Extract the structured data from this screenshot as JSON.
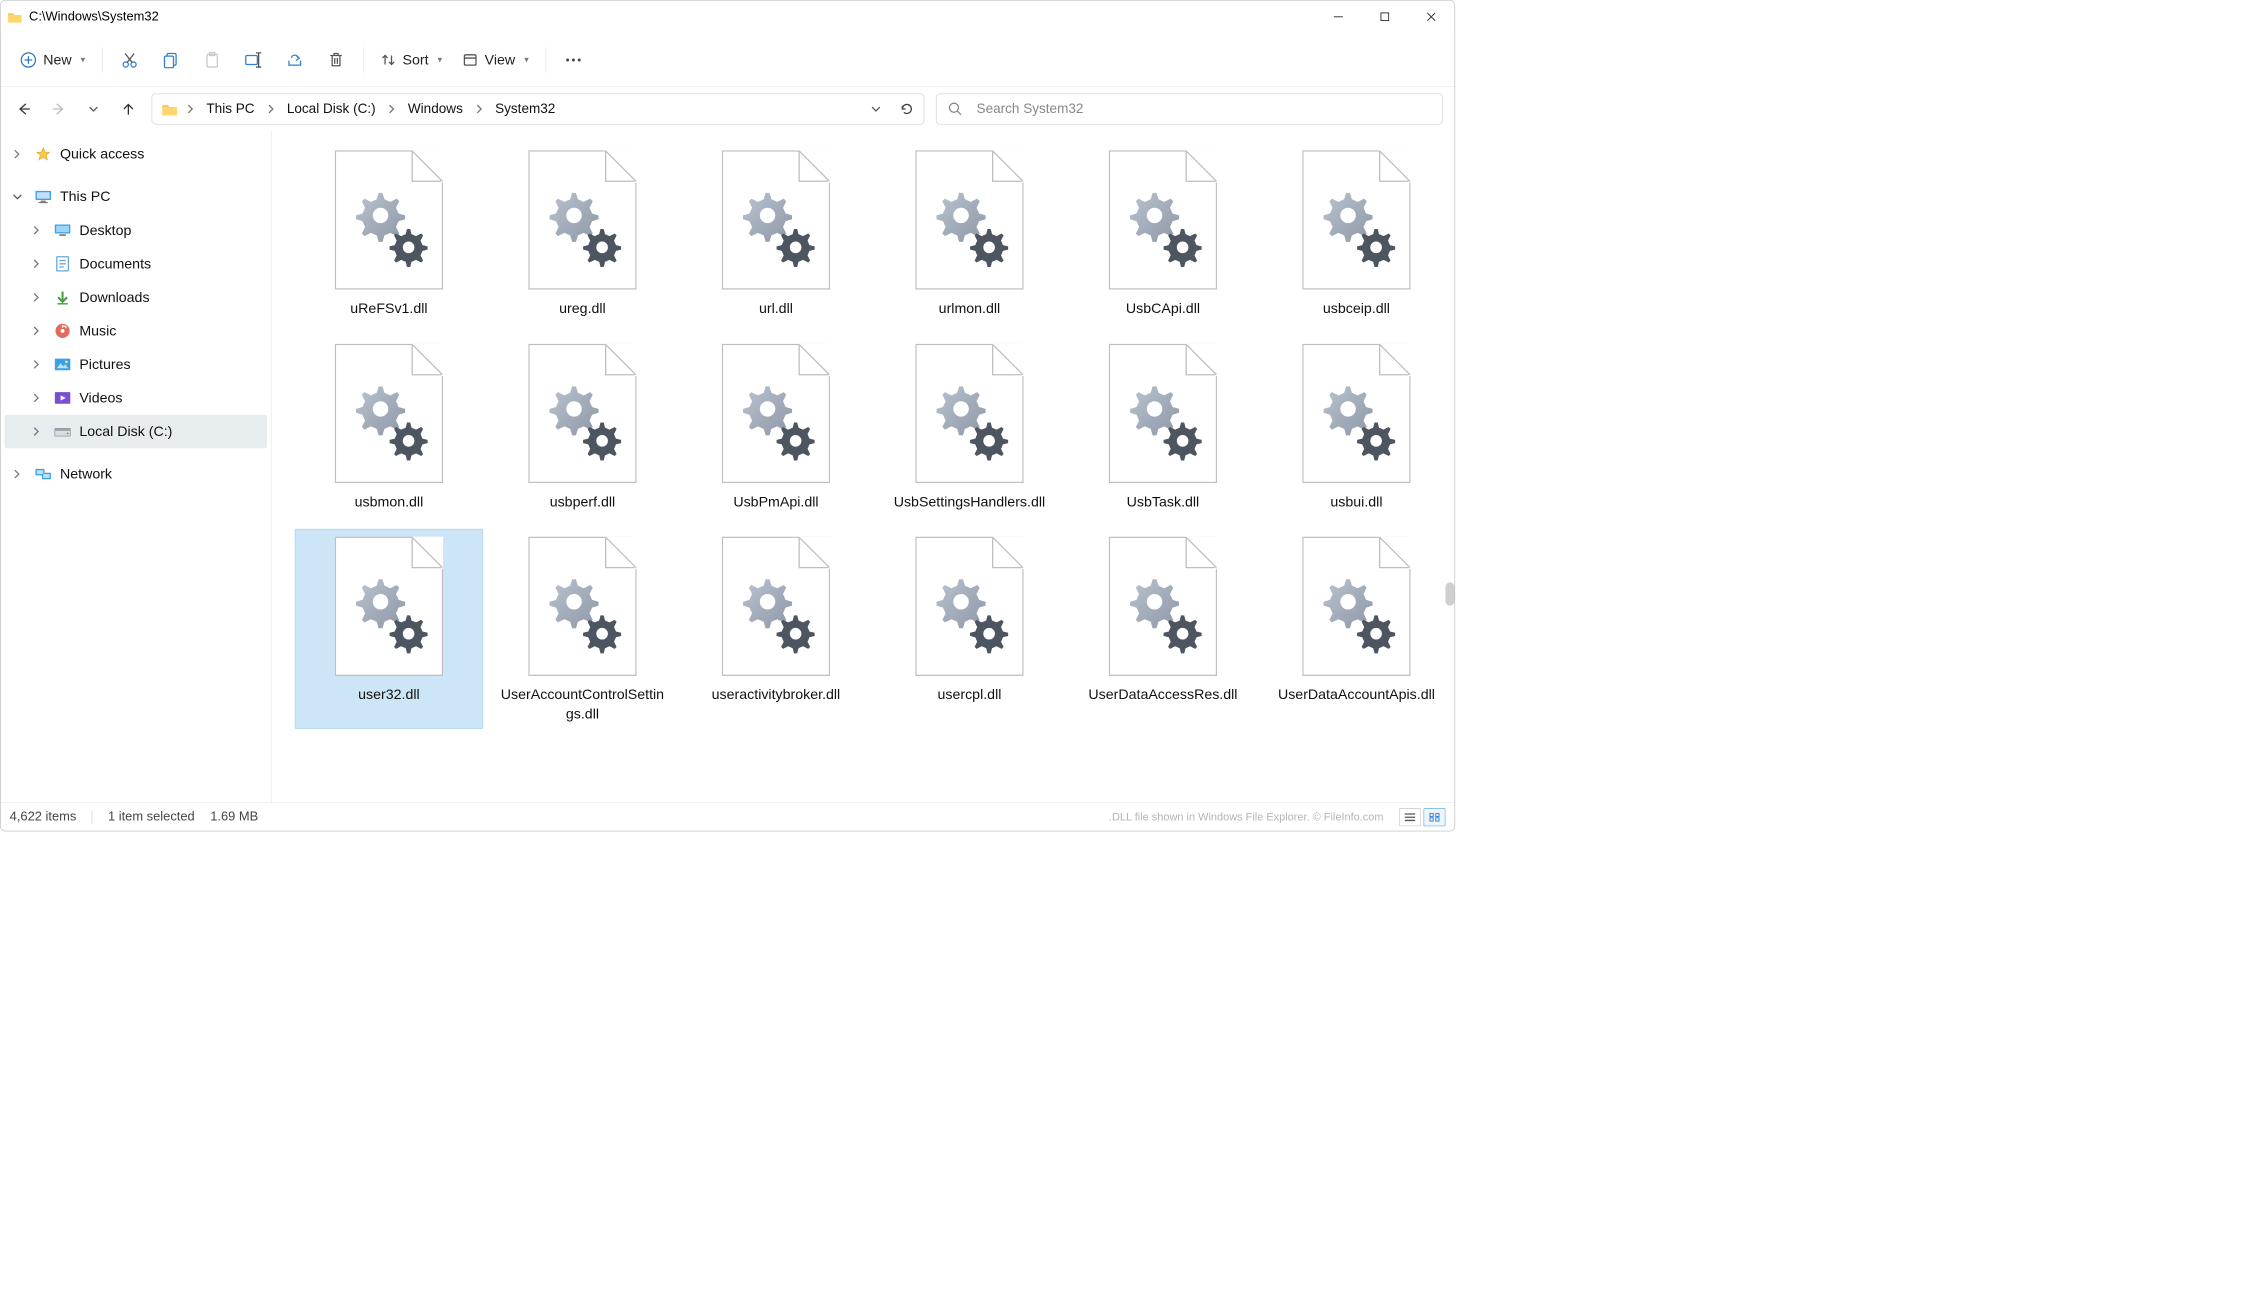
{
  "window": {
    "title_path": "C:\\Windows\\System32",
    "controls": {
      "minimize": "Minimize",
      "maximize": "Maximize",
      "close": "Close"
    }
  },
  "toolbar": {
    "new_label": "New",
    "sort_label": "Sort",
    "view_label": "View"
  },
  "breadcrumb": {
    "segments": [
      "This PC",
      "Local Disk (C:)",
      "Windows",
      "System32"
    ]
  },
  "search": {
    "placeholder": "Search System32"
  },
  "sidebar": {
    "items": [
      {
        "label": "Quick access",
        "icon": "star",
        "expandable": true,
        "expanded": false,
        "indent": 0,
        "selected": false
      },
      {
        "label": "This PC",
        "icon": "pc",
        "expandable": true,
        "expanded": true,
        "indent": 0,
        "selected": false
      },
      {
        "label": "Desktop",
        "icon": "desktop",
        "expandable": true,
        "expanded": false,
        "indent": 1,
        "selected": false
      },
      {
        "label": "Documents",
        "icon": "docs",
        "expandable": true,
        "expanded": false,
        "indent": 1,
        "selected": false
      },
      {
        "label": "Downloads",
        "icon": "down",
        "expandable": true,
        "expanded": false,
        "indent": 1,
        "selected": false
      },
      {
        "label": "Music",
        "icon": "music",
        "expandable": true,
        "expanded": false,
        "indent": 1,
        "selected": false
      },
      {
        "label": "Pictures",
        "icon": "pics",
        "expandable": true,
        "expanded": false,
        "indent": 1,
        "selected": false
      },
      {
        "label": "Videos",
        "icon": "vids",
        "expandable": true,
        "expanded": false,
        "indent": 1,
        "selected": false
      },
      {
        "label": "Local Disk (C:)",
        "icon": "disk",
        "expandable": true,
        "expanded": false,
        "indent": 1,
        "selected": true
      },
      {
        "label": "Network",
        "icon": "net",
        "expandable": true,
        "expanded": false,
        "indent": 0,
        "selected": false
      }
    ]
  },
  "files": [
    {
      "name": "uReFSv1.dll",
      "selected": false
    },
    {
      "name": "ureg.dll",
      "selected": false
    },
    {
      "name": "url.dll",
      "selected": false
    },
    {
      "name": "urlmon.dll",
      "selected": false
    },
    {
      "name": "UsbCApi.dll",
      "selected": false
    },
    {
      "name": "usbceip.dll",
      "selected": false
    },
    {
      "name": "usbmon.dll",
      "selected": false
    },
    {
      "name": "usbperf.dll",
      "selected": false
    },
    {
      "name": "UsbPmApi.dll",
      "selected": false
    },
    {
      "name": "UsbSettingsHandlers.dll",
      "selected": false
    },
    {
      "name": "UsbTask.dll",
      "selected": false
    },
    {
      "name": "usbui.dll",
      "selected": false
    },
    {
      "name": "user32.dll",
      "selected": true
    },
    {
      "name": "UserAccountControlSettings.dll",
      "selected": false
    },
    {
      "name": "useractivitybroker.dll",
      "selected": false
    },
    {
      "name": "usercpl.dll",
      "selected": false
    },
    {
      "name": "UserDataAccessRes.dll",
      "selected": false
    },
    {
      "name": "UserDataAccountApis.dll",
      "selected": false
    }
  ],
  "status": {
    "item_count_label": "4,622 items",
    "selection_label": "1 item selected",
    "selection_size": "1.69 MB",
    "credit": ".DLL file shown in Windows File Explorer. © FileInfo.com"
  }
}
